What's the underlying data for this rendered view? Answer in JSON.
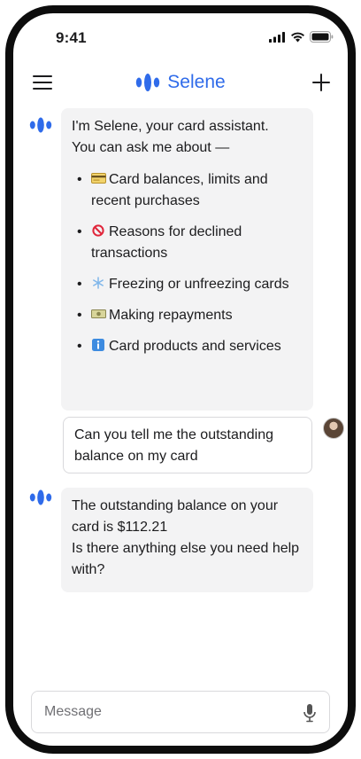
{
  "status_bar": {
    "time": "9:41"
  },
  "app": {
    "name": "Selene",
    "accent_color": "#2f6bea"
  },
  "header": {
    "menu_icon": "hamburger-menu-icon",
    "new_chat_icon": "plus-icon"
  },
  "messages": [
    {
      "role": "assistant",
      "intro": "I'm Selene, your card assistant.\nYou can ask me about —",
      "items": [
        {
          "icon": "credit-card-emoji",
          "text": "Card balances, limits and recent purchases"
        },
        {
          "icon": "prohibited-emoji",
          "text": "Reasons for declined transactions"
        },
        {
          "icon": "snowflake-emoji",
          "text": "Freezing or unfreezing cards"
        },
        {
          "icon": "money-emoji",
          "text": "Making repayments"
        },
        {
          "icon": "information-emoji",
          "text": "Card products and services"
        }
      ]
    },
    {
      "role": "user",
      "text": "Can you tell me the outstanding balance on my card"
    },
    {
      "role": "assistant",
      "text": "The outstanding balance on your card is $112.21\nIs there anything else you need help with?"
    }
  ],
  "composer": {
    "placeholder": "Message",
    "mic_icon": "microphone-icon"
  }
}
